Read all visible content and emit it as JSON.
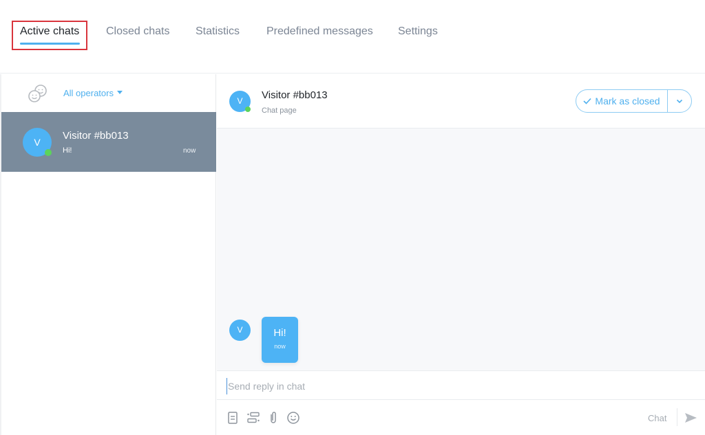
{
  "nav": {
    "tabs": [
      {
        "label": "Active chats",
        "active": true
      },
      {
        "label": "Closed chats",
        "active": false
      },
      {
        "label": "Statistics",
        "active": false
      },
      {
        "label": "Predefined messages",
        "active": false
      },
      {
        "label": "Settings",
        "active": false
      }
    ],
    "accent_color": "#4fb0ee",
    "highlight_color": "#d9343c"
  },
  "sidebar": {
    "operators_icon": "operators-icon",
    "operator_filter": "All operators",
    "chats": [
      {
        "avatar_initial": "V",
        "name": "Visitor #bb013",
        "preview": "Hi!",
        "time": "now",
        "online": true,
        "selected": true
      }
    ]
  },
  "conversation": {
    "header": {
      "avatar_initial": "V",
      "name": "Visitor #bb013",
      "subtitle": "Chat page",
      "mark_closed_label": "Mark as closed"
    },
    "messages": [
      {
        "avatar_initial": "V",
        "text": "Hi!",
        "time": "now"
      }
    ],
    "reply": {
      "placeholder": "Send reply in chat",
      "value": ""
    },
    "toolbar": {
      "icons": [
        "document-icon",
        "predefined-list-icon",
        "attachment-icon",
        "emoji-icon"
      ],
      "mode_label": "Chat",
      "send_icon": "send-icon"
    }
  }
}
